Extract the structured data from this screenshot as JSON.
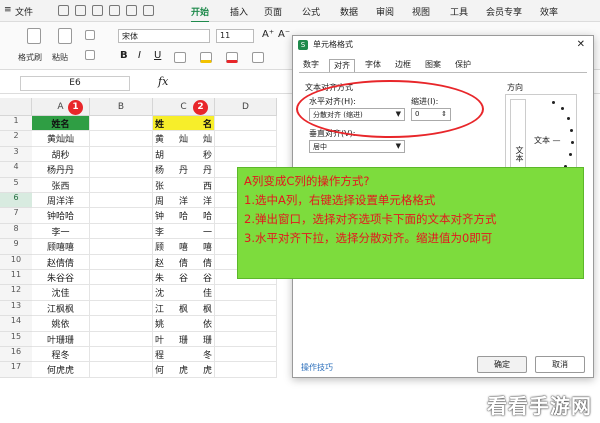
{
  "menubar": {
    "menu_icon": "≡",
    "file": "文件",
    "tabs": [
      "开始",
      "插入",
      "页面",
      "公式",
      "数据",
      "审阅",
      "视图",
      "工具",
      "会员专享",
      "效率"
    ],
    "active_tab": "开始"
  },
  "ribbon": {
    "format_painter": "格式刷",
    "paste": "粘贴",
    "font_name": "宋体",
    "font_size": "11",
    "bold": "B",
    "italic": "I",
    "underline": "U",
    "grow": "A⁺",
    "shrink": "A⁻"
  },
  "formula_bar": {
    "cell_ref": "E6",
    "fx": "fx"
  },
  "sheet": {
    "columns": [
      "A",
      "B",
      "C",
      "D"
    ],
    "rows": [
      "1",
      "2",
      "3",
      "4",
      "5",
      "6",
      "7",
      "8",
      "9",
      "10",
      "11",
      "12",
      "13",
      "14",
      "15",
      "16",
      "17"
    ],
    "selected_row": "6",
    "col_a": [
      "姓名",
      "黄灿灿",
      "胡秒",
      "杨丹丹",
      "张西",
      "周洋洋",
      "钟哈哈",
      "李一",
      "顾嘻嘻",
      "赵倩倩",
      "朱谷谷",
      "沈佳",
      "江枫枫",
      "姚依",
      "叶珊珊",
      "程冬",
      "何虎虎"
    ],
    "col_c": [
      "姓名",
      "黄灿灿",
      "胡秒",
      "杨丹丹",
      "张西",
      "周洋洋",
      "钟哈哈",
      "李一",
      "顾嘻嘻",
      "赵倩倩",
      "朱谷谷",
      "沈佳",
      "江枫枫",
      "姚依",
      "叶珊珊",
      "程冬",
      "何虎虎"
    ],
    "badge_a": "1",
    "badge_c": "2"
  },
  "dialog": {
    "title": "单元格格式",
    "close": "✕",
    "tabs": [
      "数字",
      "对齐",
      "字体",
      "边框",
      "图案",
      "保护"
    ],
    "active_tab": "对齐",
    "text_align_group": "文本对齐方式",
    "horizontal_label": "水平对齐(H):",
    "horizontal_value": "分散对齐 (缩进)",
    "indent_label": "缩进(I):",
    "indent_value": "0",
    "vertical_label": "垂直对齐(V):",
    "vertical_value": "居中",
    "orientation_label": "方向",
    "vertical_text": "文本",
    "angle_text": "文本 —",
    "tips": "操作技巧",
    "ok": "确定",
    "cancel": "取消"
  },
  "annotation": {
    "line1": "A列变成C列的操作方式?",
    "line2": "1.选中A列，右键选择设置单元格格式",
    "line3": "2.弹出窗口，选择对齐选项卡下面的文本对齐方式",
    "line4": "3.水平对齐下拉，选择分散对齐。缩进值为0即可"
  },
  "watermark": "看看手游网"
}
